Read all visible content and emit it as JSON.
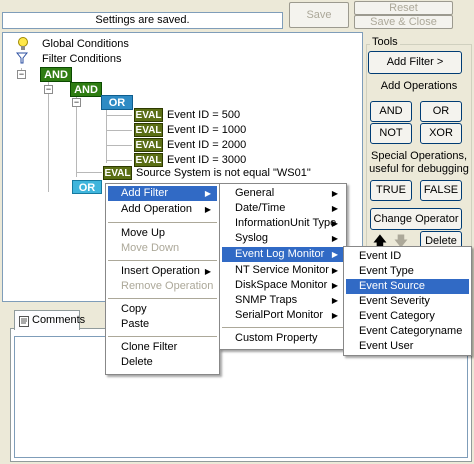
{
  "toolbar": {
    "status_text": "Settings are saved.",
    "save_label": "Save",
    "reset_label": "Reset",
    "save_close_label": "Save & Close"
  },
  "tree": {
    "global_conditions": "Global Conditions",
    "filter_conditions": "Filter Conditions",
    "and_label": "AND",
    "or_label": "OR",
    "eval_label": "EVAL",
    "eval_items": [
      "Event ID = 500",
      "Event ID = 1000",
      "Event ID = 2000",
      "Event ID = 3000"
    ],
    "source_eval": "Source System is not equal \"WS01\"",
    "expander_minus": "−"
  },
  "tools": {
    "title": "Tools",
    "add_filter": "Add Filter >",
    "add_operations": "Add Operations",
    "and": "AND",
    "or": "OR",
    "not": "NOT",
    "xor": "XOR",
    "special_ops": "Special Operations,",
    "special_ops2": "useful for debugging",
    "true": "TRUE",
    "false": "FALSE",
    "change_operator": "Change Operator",
    "delete": "Delete",
    "up_arrow": "🡅",
    "down_arrow": "🡇"
  },
  "comments": {
    "tab_label": "Comments"
  },
  "context_menu": {
    "items": [
      {
        "label": "Add Filter",
        "submenu": true,
        "selected": true,
        "disabled": false
      },
      {
        "label": "Add Operation",
        "submenu": true,
        "selected": false,
        "disabled": false
      },
      {
        "label": "Move Up",
        "submenu": false,
        "selected": false,
        "disabled": false
      },
      {
        "label": "Move Down",
        "submenu": false,
        "selected": false,
        "disabled": true
      },
      {
        "label": "Insert Operation",
        "submenu": true,
        "selected": false,
        "disabled": false
      },
      {
        "label": "Remove Operation",
        "submenu": false,
        "selected": false,
        "disabled": true
      },
      {
        "label": "Copy",
        "submenu": false,
        "selected": false,
        "disabled": false
      },
      {
        "label": "Paste",
        "submenu": false,
        "selected": false,
        "disabled": false
      },
      {
        "label": "Clone Filter",
        "submenu": false,
        "selected": false,
        "disabled": false
      },
      {
        "label": "Delete",
        "submenu": false,
        "selected": false,
        "disabled": false
      }
    ]
  },
  "filter_menu": {
    "items": [
      {
        "label": "General",
        "selected": false
      },
      {
        "label": "Date/Time",
        "selected": false
      },
      {
        "label": "InformationUnit Type",
        "selected": false
      },
      {
        "label": "Syslog",
        "selected": false
      },
      {
        "label": "Event Log Monitor",
        "selected": true
      },
      {
        "label": "NT Service Monitor",
        "selected": false
      },
      {
        "label": "DiskSpace Monitor",
        "selected": false
      },
      {
        "label": "SNMP Traps",
        "selected": false
      },
      {
        "label": "SerialPort Monitor",
        "selected": false
      },
      {
        "label": "Custom Property",
        "selected": false
      }
    ]
  },
  "eventlog_menu": {
    "items": [
      {
        "label": "Event ID",
        "selected": false
      },
      {
        "label": "Event Type",
        "selected": false
      },
      {
        "label": "Event Source",
        "selected": true
      },
      {
        "label": "Event Severity",
        "selected": false
      },
      {
        "label": "Event Category",
        "selected": false
      },
      {
        "label": "Event Categoryname",
        "selected": false
      },
      {
        "label": "Event User",
        "selected": false
      }
    ]
  },
  "colors": {
    "selection": "#316ac5",
    "and_tag": "#2e7d12",
    "or_tag": "#2e8bc4",
    "eval_tag": "#5a6e14"
  }
}
